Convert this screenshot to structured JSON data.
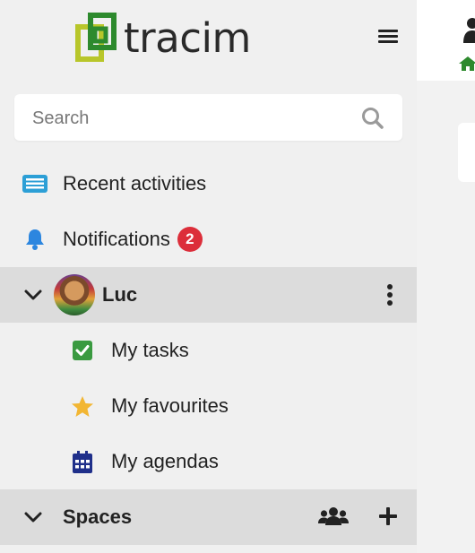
{
  "app": {
    "logo_text": "tracim",
    "logo_colors": {
      "green": "#2d8a2d",
      "lime": "#b8c62a"
    }
  },
  "search": {
    "placeholder": "Search"
  },
  "nav": {
    "recent_activities": "Recent activities",
    "notifications": "Notifications",
    "notifications_count": "2"
  },
  "user": {
    "name": "Luc",
    "items": [
      {
        "label": "My tasks",
        "icon": "check-square-icon"
      },
      {
        "label": "My favourites",
        "icon": "star-icon"
      },
      {
        "label": "My agendas",
        "icon": "calendar-icon"
      }
    ]
  },
  "spaces": {
    "label": "Spaces"
  },
  "colors": {
    "sidebar_bg": "#f0f0f0",
    "active_row_bg": "#dcdcdc",
    "badge_red": "#dc2e3a",
    "recent_blue": "#2c9fd6",
    "bell_blue": "#2c86df",
    "task_green": "#3a9a40",
    "star_yellow": "#f2b633",
    "agenda_navy": "#1f2f8a"
  }
}
